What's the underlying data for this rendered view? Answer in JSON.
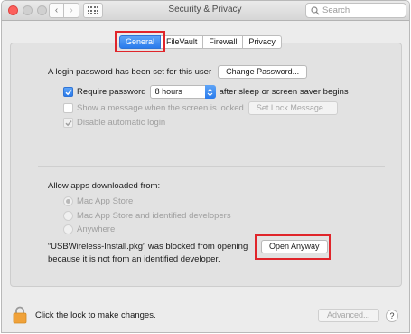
{
  "window": {
    "title": "Security & Privacy"
  },
  "toolbar": {
    "search_placeholder": "Search",
    "back_glyph": "‹",
    "forward_glyph": "›"
  },
  "tabs": [
    {
      "label": "General",
      "active": true
    },
    {
      "label": "FileVault",
      "active": false
    },
    {
      "label": "Firewall",
      "active": false
    },
    {
      "label": "Privacy",
      "active": false
    }
  ],
  "general": {
    "login_password_text": "A login password has been set for this user",
    "change_password_label": "Change Password...",
    "require_password_label": "Require password",
    "require_password_checked": true,
    "require_password_interval": "8 hours",
    "after_sleep_text": "after sleep or screen saver begins",
    "show_message_label": "Show a message when the screen is locked",
    "show_message_checked": false,
    "set_lock_message_label": "Set Lock Message...",
    "disable_auto_login_label": "Disable automatic login",
    "disable_auto_login_checked": true
  },
  "allow_apps": {
    "heading": "Allow apps downloaded from:",
    "options": [
      {
        "label": "Mac App Store",
        "selected": true
      },
      {
        "label": "Mac App Store and identified developers",
        "selected": false
      },
      {
        "label": "Anywhere",
        "selected": false
      }
    ],
    "blocked_line1": "“USBWireless-Install.pkg” was blocked from opening",
    "blocked_line2": "because it is not from an identified developer.",
    "open_anyway_label": "Open Anyway"
  },
  "footer": {
    "lock_text": "Click the lock to make changes.",
    "advanced_label": "Advanced...",
    "help_glyph": "?"
  },
  "colors": {
    "accent": "#2a7bec",
    "highlight": "#e0252b",
    "lock_body": "#f0a23a"
  }
}
